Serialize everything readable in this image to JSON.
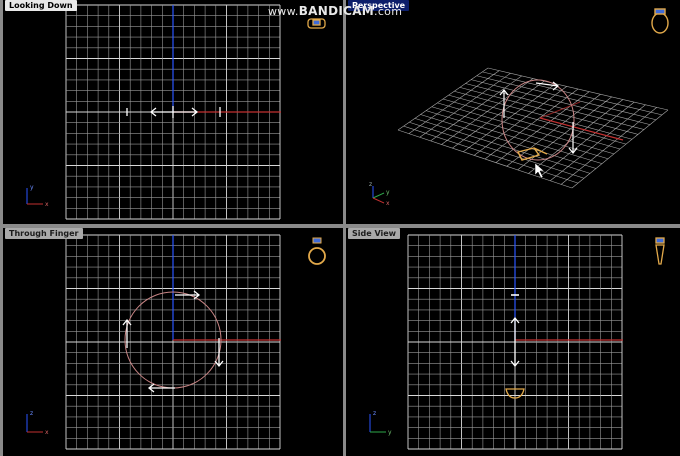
{
  "watermark": {
    "prefix": "www.",
    "brand": "BANDICAM",
    "suffix": ".com"
  },
  "viewports": {
    "top": {
      "title": "Looking Down"
    },
    "perspective": {
      "title": "Perspective"
    },
    "front": {
      "title": "Through Finger"
    },
    "side": {
      "title": "Side View"
    }
  },
  "axes": {
    "top": [
      "y",
      "x"
    ],
    "front": [
      "z",
      "x"
    ],
    "side": [
      "z",
      "y"
    ],
    "perspective": [
      "z",
      "y",
      "x"
    ]
  },
  "colors": {
    "grid": "#bdbdbd",
    "axis_y": "#2a55ff",
    "axis_x": "#d03030",
    "ring": "#e2a94a",
    "arrow": "#ffffff",
    "circle": "#c98585"
  }
}
